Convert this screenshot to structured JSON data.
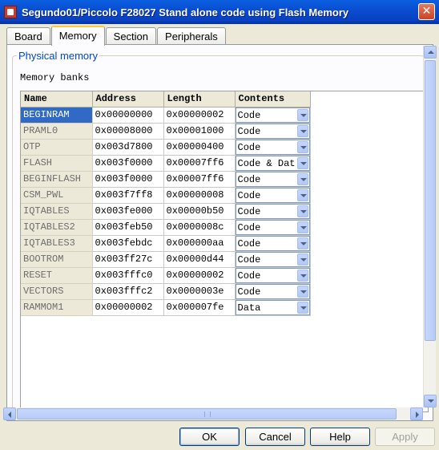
{
  "window": {
    "title": "Segundo01/Piccolo F28027 Stand alone code using Flash Memory",
    "close_glyph": "✕"
  },
  "tabs": [
    {
      "label": "Board",
      "active": false
    },
    {
      "label": "Memory",
      "active": true
    },
    {
      "label": "Section",
      "active": false
    },
    {
      "label": "Peripherals",
      "active": false
    }
  ],
  "group": {
    "label": "Physical memory",
    "banks_label": "Memory banks"
  },
  "table": {
    "headers": [
      "Name",
      "Address",
      "Length",
      "Contents"
    ],
    "rows": [
      {
        "name": "BEGINRAM",
        "address": "0x00000000",
        "length": "0x00000002",
        "contents": "Code",
        "selected": true
      },
      {
        "name": "PRAML0",
        "address": "0x00008000",
        "length": "0x00001000",
        "contents": "Code"
      },
      {
        "name": "OTP",
        "address": "0x003d7800",
        "length": "0x00000400",
        "contents": "Code"
      },
      {
        "name": "FLASH",
        "address": "0x003f0000",
        "length": "0x00007ff6",
        "contents": "Code & Dat"
      },
      {
        "name": "BEGINFLASH",
        "address": "0x003f0000",
        "length": "0x00007ff6",
        "contents": "Code"
      },
      {
        "name": "CSM_PWL",
        "address": "0x003f7ff8",
        "length": "0x00000008",
        "contents": "Code"
      },
      {
        "name": "IQTABLES",
        "address": "0x003fe000",
        "length": "0x00000b50",
        "contents": "Code"
      },
      {
        "name": "IQTABLES2",
        "address": "0x003feb50",
        "length": "0x0000008c",
        "contents": "Code"
      },
      {
        "name": "IQTABLES3",
        "address": "0x003febdc",
        "length": "0x000000aa",
        "contents": "Code"
      },
      {
        "name": "BOOTROM",
        "address": "0x003ff27c",
        "length": "0x00000d44",
        "contents": "Code"
      },
      {
        "name": "RESET",
        "address": "0x003fffc0",
        "length": "0x00000002",
        "contents": "Code"
      },
      {
        "name": "VECTORS",
        "address": "0x003fffc2",
        "length": "0x0000003e",
        "contents": "Code"
      },
      {
        "name": "RAMMOM1",
        "address": "0x00000002",
        "length": "0x000007fe",
        "contents": "Data"
      }
    ]
  },
  "buttons": {
    "ok": "OK",
    "cancel": "Cancel",
    "help": "Help",
    "apply": "Apply"
  }
}
